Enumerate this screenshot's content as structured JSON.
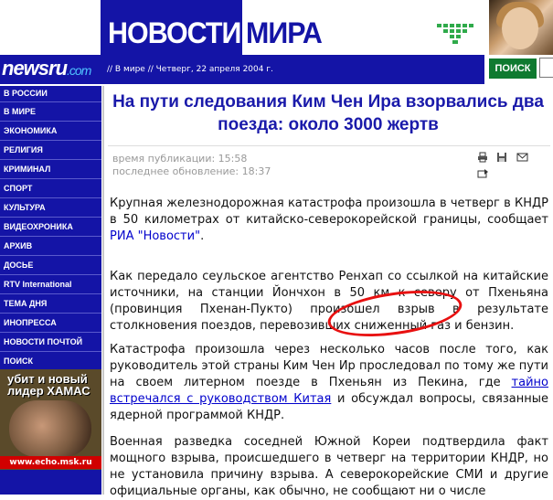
{
  "header": {
    "title_part1": "НОВОСТИ",
    "title_part2": "МИРА",
    "logo_main": "newsru",
    "logo_domain": ".com",
    "breadcrumb": "// В мире // Четверг, 22 апреля 2004 г.",
    "search_label": "ПОИСК"
  },
  "sidebar": {
    "items": [
      {
        "label": "В РОССИИ"
      },
      {
        "label": "В МИРЕ"
      },
      {
        "label": "ЭКОНОМИКА"
      },
      {
        "label": "РЕЛИГИЯ"
      },
      {
        "label": "КРИМИНАЛ"
      },
      {
        "label": "СПОРТ"
      },
      {
        "label": "КУЛЬТУРА"
      },
      {
        "label": "ВИДЕОХРОНИКА"
      },
      {
        "label": "АРХИВ"
      },
      {
        "label": "ДОСЬЕ"
      },
      {
        "label": "RTV International"
      },
      {
        "label": "ТЕМА ДНЯ"
      },
      {
        "label": "ИНОПРЕССА"
      },
      {
        "label": "НОВОСТИ ПОЧТОЙ"
      },
      {
        "label": "ПОИСК"
      }
    ],
    "ad": {
      "text_line1": "убит и новый",
      "text_line2": "лидер ХАМАС",
      "url": "www.echo.msk.ru"
    }
  },
  "article": {
    "headline": "На пути следования Ким Чен Ира взорвались два поезда: около 3000 жертв",
    "published": "время публикации: 15:58",
    "updated": "последнее обновление: 18:37",
    "p1_text": "Крупная железнодорожная катастрофа произошла в четверг в КНДР в 50 километрах от китайско-северокорейской границы, сообщает ",
    "p1_link": "РИА \"Новости\"",
    "p1_end": ".",
    "p2": "Как передало сеульское агентство Ренхап со ссылкой на китайские источники, на станции Йончхон в 50 км к северу от Пхеньяна (провинция Пхенан-Пукто) произошел взрыв в результате столкновения поездов, перевозивших сниженный газ и бензин.",
    "p3_text": "Катастрофа произошла через несколько часов после того, как руководитель этой страны Ким Чен Ир проследовал по тому же пути на своем литерном поезде в Пхеньян из Пекина, где ",
    "p3_link": "тайно встречался с руководством Китая",
    "p3_end": " и обсуждал вопросы, связанные ядерной программой КНДР.",
    "p4": "Военная разведка соседней Южной Кореи подтвердила факт мощного взрыва, происшедшего в четверг на территории КНДР, но не установила причину взрыва. А северокорейские СМИ и другие официальные органы, как обычно, не сообщают ни о числе"
  },
  "colors": {
    "brand_blue": "#1414a6",
    "headline_blue": "#1a1aaa",
    "search_green": "#0f7a30",
    "annotation_red": "#e81010"
  },
  "icons": [
    "print-icon",
    "save-icon",
    "email-icon",
    "send-icon"
  ]
}
